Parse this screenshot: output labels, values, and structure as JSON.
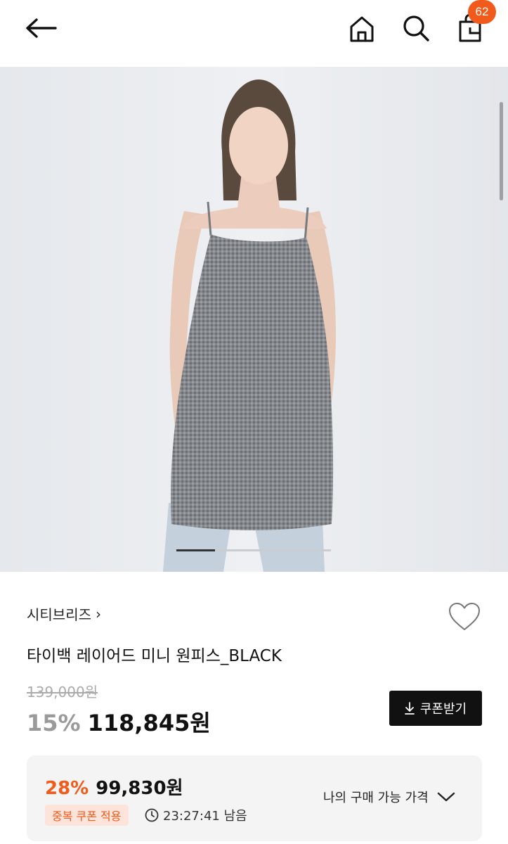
{
  "header": {
    "back_icon": "arrow-left-icon",
    "home_icon": "home-icon",
    "search_icon": "search-icon",
    "cart_icon": "shopping-bag-icon",
    "cart_count": "62",
    "badge_color": "#f05a1a"
  },
  "gallery": {
    "image_alt": "product photo",
    "current_slide": 1
  },
  "product": {
    "brand": "시티브리즈",
    "brand_chevron": "›",
    "name": "타이백 레이어드 미니 원피스_BLACK",
    "original_price": "139,000원",
    "discount_rate": "15%",
    "sale_price": "118,845원",
    "wish_icon": "heart-icon"
  },
  "coupon_button": {
    "icon": "download-icon",
    "label": "쿠폰받기"
  },
  "best_price": {
    "rate": "28%",
    "price": "99,830원",
    "badge": "중복 쿠폰 적용",
    "timer_icon": "clock-icon",
    "timer": "23:27:41 남음",
    "toggle_label": "나의 구매 가능 가격",
    "toggle_icon": "chevron-down-icon",
    "accent_color": "#f05a1a"
  }
}
